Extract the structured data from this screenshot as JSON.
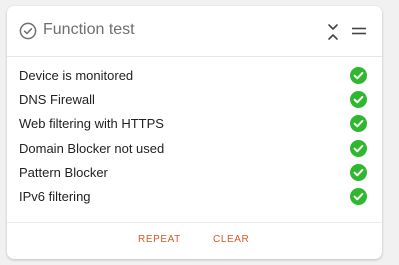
{
  "card": {
    "title": "Function test",
    "title_icon": "check-circle-outline-icon",
    "collapse_icon": "collapse-chevrons-icon",
    "menu_icon": "drag-handle-icon"
  },
  "checks": [
    {
      "label": "Device is monitored",
      "status": "ok"
    },
    {
      "label": "DNS Firewall",
      "status": "ok"
    },
    {
      "label": "Web filtering with HTTPS",
      "status": "ok"
    },
    {
      "label": "Domain Blocker not used",
      "status": "ok"
    },
    {
      "label": "Pattern Blocker",
      "status": "ok"
    },
    {
      "label": "IPv6 filtering",
      "status": "ok"
    }
  ],
  "actions": {
    "repeat_label": "REPEAT",
    "clear_label": "CLEAR"
  },
  "colors": {
    "ok": "#2eb82e",
    "accent": "#d9582b",
    "title": "#6f6f6f"
  }
}
